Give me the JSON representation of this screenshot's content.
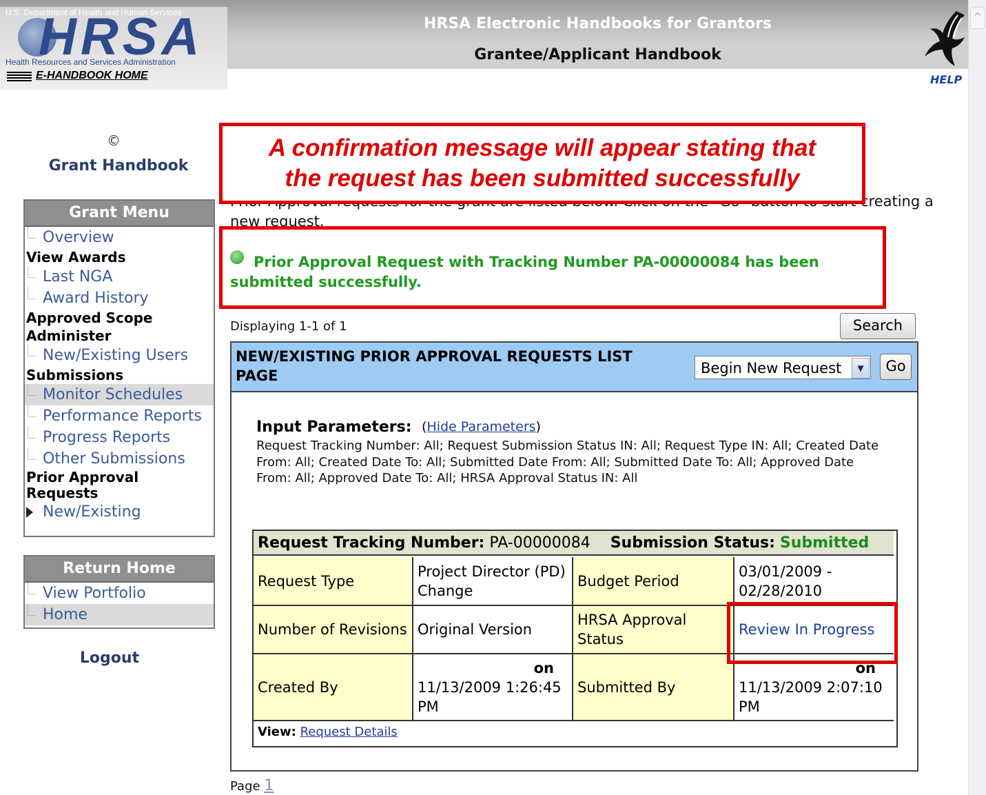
{
  "header": {
    "dept": "U.S. Department of Health and Human Services",
    "logo_text": "HRSA",
    "agency": "Health Resources and Services Administration",
    "home_link": "E-HANDBOOK HOME",
    "title": "HRSA Electronic Handbooks for Grantors",
    "subtitle": "Grantee/Applicant Handbook",
    "help": "HELP"
  },
  "sidebar": {
    "collapse_glyph": "©",
    "title": "Grant Handbook",
    "grant_menu": {
      "heading": "Grant Menu",
      "items": [
        {
          "type": "link",
          "label": "Overview"
        },
        {
          "type": "header",
          "label": "View Awards"
        },
        {
          "type": "link",
          "label": "Last NGA"
        },
        {
          "type": "link",
          "label": "Award History"
        },
        {
          "type": "header",
          "label": "Approved Scope"
        },
        {
          "type": "header",
          "label": "Administer"
        },
        {
          "type": "link",
          "label": "New/Existing Users"
        },
        {
          "type": "header",
          "label": "Submissions"
        },
        {
          "type": "link",
          "label": "Monitor Schedules",
          "selected": true
        },
        {
          "type": "link",
          "label": "Performance Reports"
        },
        {
          "type": "link",
          "label": "Progress Reports"
        },
        {
          "type": "link",
          "label": "Other Submissions"
        },
        {
          "type": "header",
          "label": "Prior Approval Requests"
        },
        {
          "type": "current",
          "label": "New/Existing"
        }
      ]
    },
    "return_home": {
      "heading": "Return Home",
      "items": [
        "View Portfolio",
        "Home"
      ]
    },
    "logout": "Logout"
  },
  "callout": {
    "line1": "A confirmation message will appear stating that",
    "line2": "the request has been submitted successfully"
  },
  "intro_text": "Prior Approval requests for the grant are listed below. Click on the \"Go\" button to start creating a new request.",
  "success_message": "Prior Approval Request with Tracking Number PA-00000084 has been submitted successfully.",
  "list": {
    "displaying": "Displaying 1-1 of 1",
    "search_button": "Search",
    "title": "NEW/EXISTING PRIOR APPROVAL REQUESTS LIST PAGE",
    "select_value": "Begin New Request",
    "go_button": "Go",
    "params_label": "Input Parameters:",
    "params_toggle": "Hide Parameters",
    "params_text": "Request Tracking Number: All; Request Submission Status IN: All; Request Type IN: All; Created Date From: All; Created Date To: All; Submitted Date From: All; Submitted Date To: All; Approved Date From: All; Approved Date To: All; HRSA Approval Status IN: All",
    "page_label": "Page",
    "page_number": "1"
  },
  "request": {
    "tracking_label": "Request Tracking Number:",
    "tracking_number": "PA-00000084",
    "status_label": "Submission Status:",
    "status_value": "Submitted",
    "rows": {
      "request_type_label": "Request Type",
      "request_type_value": "Project Director (PD) Change",
      "budget_period_label": "Budget Period",
      "budget_period_value": "03/01/2009 - 02/28/2010",
      "revisions_label": "Number of Revisions",
      "revisions_value": "Original Version",
      "approval_label": "HRSA Approval Status",
      "approval_value": "Review In Progress",
      "created_by_label": "Created By",
      "created_on": "on",
      "created_value": "11/13/2009 1:26:45 PM",
      "submitted_by_label": "Submitted By",
      "submitted_on": "on",
      "submitted_value": "11/13/2009 2:07:10 PM"
    },
    "view_label": "View:",
    "view_link": "Request Details"
  },
  "colors": {
    "annotation": "#e00000",
    "success": "#1f9a1f",
    "panel_header": "#9dcbf3",
    "label_cell": "#ffffcc"
  }
}
